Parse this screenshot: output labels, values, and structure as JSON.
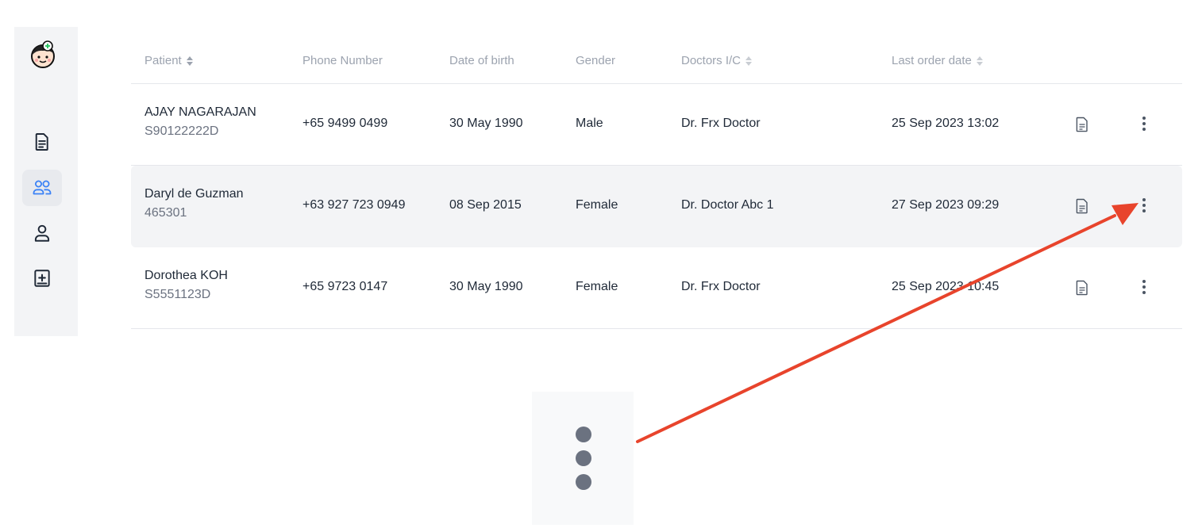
{
  "sidebar": {
    "icons": [
      "logo-icon",
      "document-icon",
      "users-icon",
      "user-icon",
      "medical-record-icon"
    ],
    "active": "users-icon"
  },
  "table": {
    "headers": {
      "patient": "Patient",
      "phone": "Phone Number",
      "dob": "Date of birth",
      "gender": "Gender",
      "doctors": "Doctors I/C",
      "last_order": "Last order date"
    },
    "rows": [
      {
        "name": "AJAY NAGARAJAN",
        "id": "S90122222D",
        "phone": "+65 9499 0499",
        "dob": "30 May 1990",
        "gender": "Male",
        "doctor": "Dr. Frx Doctor",
        "last_order": "25 Sep 2023 13:02"
      },
      {
        "name": "Daryl de Guzman",
        "id": "465301",
        "phone": "+63 927 723 0949",
        "dob": "08 Sep 2015",
        "gender": "Female",
        "doctor": "Dr. Doctor Abc 1",
        "last_order": "27 Sep 2023 09:29"
      },
      {
        "name": "Dorothea KOH",
        "id": "S5551123D",
        "phone": "+65 9723 0147",
        "dob": "30 May 1990",
        "gender": "Female",
        "doctor": "Dr. Frx Doctor",
        "last_order": "25 Sep 2023 10:45"
      }
    ]
  },
  "colors": {
    "accent": "#3b82f6",
    "annotation_arrow": "#e8442c",
    "sidebar_bg": "#f3f4f6"
  }
}
